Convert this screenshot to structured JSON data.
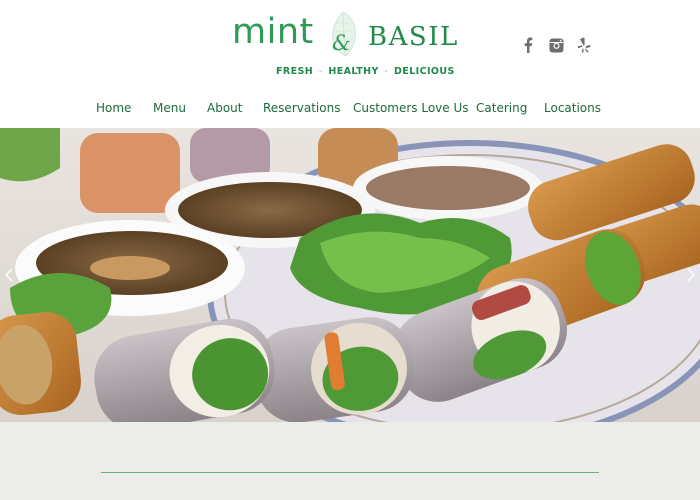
{
  "brand": {
    "name_part1": "mint",
    "ampersand": "&",
    "name_part2": "BASIL",
    "tagline": [
      "FRESH",
      "HEALTHY",
      "DELICIOUS"
    ],
    "tagline_separator": "-",
    "primary_color": "#2e9a57",
    "dark_green": "#1c6b3a"
  },
  "social": [
    {
      "icon": "facebook-icon"
    },
    {
      "icon": "instagram-icon"
    },
    {
      "icon": "yelp-icon"
    }
  ],
  "nav": {
    "items": [
      {
        "label": "Home"
      },
      {
        "label": "Menu"
      },
      {
        "label": "About"
      },
      {
        "label": "Reservations"
      },
      {
        "label": "Customers Love Us"
      },
      {
        "label": "Catering"
      },
      {
        "label": "Locations"
      }
    ]
  },
  "hero": {
    "image": "platter of spring rolls, egg rolls and dipping sauces",
    "prev_icon": "chevron-left-icon",
    "next_icon": "chevron-right-icon"
  },
  "content": {
    "background": "#ececea",
    "divider_color": "#6ab37f"
  }
}
